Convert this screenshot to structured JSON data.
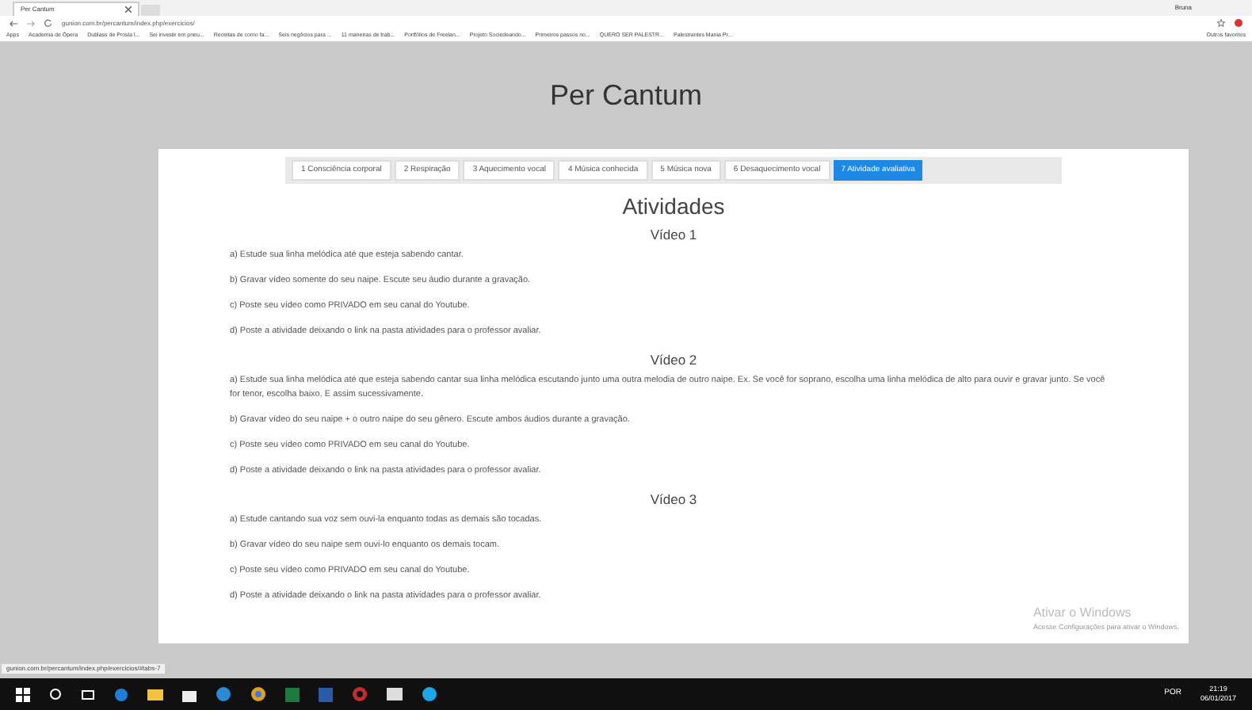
{
  "browser": {
    "tab_title": "Per Cantum",
    "user": "Bruna",
    "address": "gunion.com.br/percantum/index.php/exercicios/",
    "bookmarks": [
      "Apps",
      "Academia de Ópera",
      "Dublass de Prosla l...",
      "Sei investir em pneu...",
      "Receitas de como fa...",
      "Seis negócios para ...",
      "11 maneiras de trab...",
      "Portfólios de Freelan...",
      "Projeto Sociedeando...",
      "Primeiros passos no...",
      "QUERO SER PALESTR...",
      "Palestrantes Mania Pr..."
    ],
    "other_bookmarks": "Outros favoritos"
  },
  "site_title": "Per Cantum",
  "tabs": [
    {
      "label": "1 Consciência corporal",
      "selected": false
    },
    {
      "label": "2 Respiração",
      "selected": false
    },
    {
      "label": "3 Aquecimento vocal",
      "selected": false
    },
    {
      "label": "4 Música conhecida",
      "selected": false
    },
    {
      "label": "5 Música nova",
      "selected": false
    },
    {
      "label": "6 Desaquecimento vocal",
      "selected": false
    },
    {
      "label": "7 Atividade avaliativa",
      "selected": true
    }
  ],
  "heading": "Atividades",
  "sections": [
    {
      "title": "Vídeo 1",
      "items": [
        "a) Estude sua linha melódica até que esteja sabendo cantar.",
        "b) Gravar vídeo somente do seu naipe. Escute seu áudio durante a gravação.",
        "c) Poste seu vídeo como PRIVADO em seu canal do Youtube.",
        "d) Poste a atividade deixando o link na pasta atividades para o professor avaliar."
      ]
    },
    {
      "title": "Vídeo 2",
      "items": [
        "a) Estude sua linha melódica até que esteja sabendo cantar sua linha melódica escutando junto uma outra melodia de outro naipe. Ex. Se você for soprano, escolha uma linha melódica de alto para ouvir e gravar junto. Se você for tenor, escolha baixo. E assim sucessivamente.",
        "b) Gravar vídeo do seu naipe + o outro naipe do seu gênero. Escute ambos áudios durante a gravação.",
        "c) Poste seu vídeo como PRIVADO em seu canal do Youtube.",
        "d) Poste a atividade deixando o link na pasta atividades para o professor avaliar."
      ]
    },
    {
      "title": "Vídeo 3",
      "items": [
        "a) Estude cantando sua voz sem ouvi-la enquanto todas as demais são tocadas.",
        "b) Gravar vídeo do seu naipe sem ouvi-lo enquanto os demais tocam.",
        "c) Poste seu vídeo como PRIVADO em seu canal do Youtube.",
        "d) Poste a atividade deixando o link na pasta atividades para o professor avaliar."
      ]
    }
  ],
  "status_url": "gunion.com.br/percantum/index.php/exercicios/#tabs-7",
  "activation": {
    "title": "Ativar o Windows",
    "subtitle": "Acesse Configurações para ativar o Windows."
  },
  "taskbar": {
    "language": "POR",
    "time": "21:19",
    "date": "06/01/2017"
  }
}
